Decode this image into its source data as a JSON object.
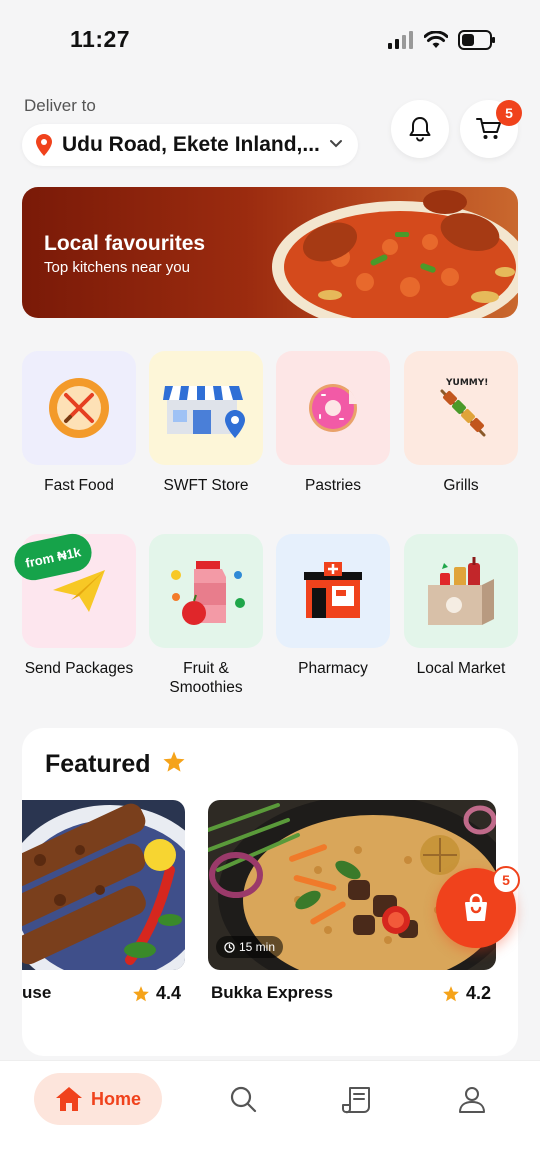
{
  "status": {
    "time": "11:27"
  },
  "header": {
    "deliver_label": "Deliver to",
    "address": "Udu Road, Ekete Inland,...",
    "cart_count": "5"
  },
  "banner": {
    "title": "Local favourites",
    "subtitle": "Top kitchens near you"
  },
  "categories": [
    {
      "label": "Fast Food",
      "icon": "fast-food-icon",
      "bg": "#eeeefc"
    },
    {
      "label": "SWFT Store",
      "icon": "store-icon",
      "bg": "#fdf6d8"
    },
    {
      "label": "Pastries",
      "icon": "donut-icon",
      "bg": "#fde6e6"
    },
    {
      "label": "Grills",
      "icon": "skewer-icon",
      "bg": "#fde9e0"
    },
    {
      "label": "Send Packages",
      "icon": "paper-plane-icon",
      "bg": "#fde6ee",
      "tag": "from ₦1k"
    },
    {
      "label": "Fruit &\nSmoothies",
      "icon": "fruit-icon",
      "bg": "#e3f5ea"
    },
    {
      "label": "Pharmacy",
      "icon": "pharmacy-icon",
      "bg": "#e6f0fc"
    },
    {
      "label": "Local Market",
      "icon": "market-icon",
      "bg": "#e3f5ea"
    }
  ],
  "featured": {
    "title": "Featured",
    "items": [
      {
        "name": "use",
        "rating": "4.4"
      },
      {
        "name": "Bukka Express",
        "rating": "4.2",
        "time": "15 min"
      }
    ]
  },
  "fab": {
    "count": "5"
  },
  "nav": {
    "home_label": "Home"
  },
  "colors": {
    "accent": "#f0421c",
    "tag_green": "#16a34a",
    "star": "#f5a31a"
  }
}
